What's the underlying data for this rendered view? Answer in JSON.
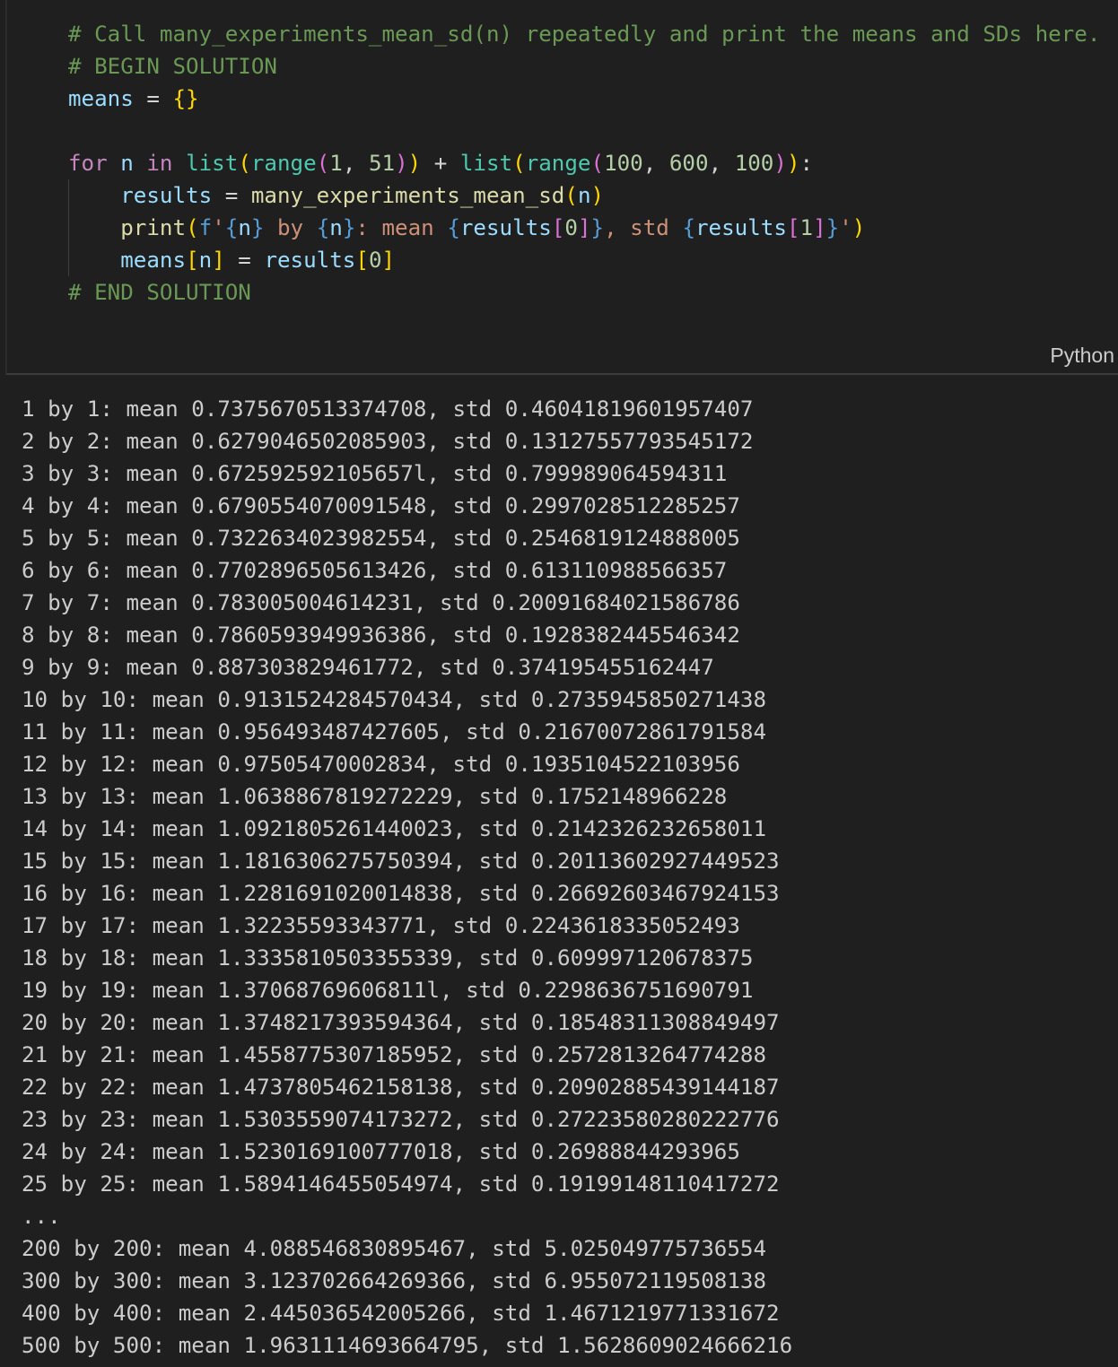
{
  "code_cell": {
    "language_label": "Python",
    "comment_line1": "# Call many_experiments_mean_sd(n) repeatedly and print the means and SDs here.",
    "comment_line2": "# BEGIN SOLUTION",
    "comment_end": "# END SOLUTION"
  },
  "output_lines": [
    "1 by 1: mean 0.7375670513374708, std 0.46041819601957407",
    "2 by 2: mean 0.6279046502085903, std 0.13127557793545172",
    "3 by 3: mean 0.672592592105657l, std 0.799989064594311",
    "4 by 4: mean 0.6790554070091548, std 0.2997028512285257",
    "5 by 5: mean 0.732263402398255­4, std 0.2546819124888005",
    "6 by 6: mean 0.7702896505613426, std 0.613110988566357",
    "7 by 7: mean 0.783005004614231, std 0.20091684021586786",
    "8 by 8: mean 0.7860593949936386, std 0.1928382445546342",
    "9 by 9: mean 0.887303829461772, std 0.374195455162447",
    "10 by 10: mean 0.9131524284570434, std 0.2735945850271438",
    "11 by 11: mean 0.956493487427605, std 0.21670072861791584",
    "12 by 12: mean 0.97505470002834, std 0.1935104522103956",
    "13 by 13: mean 1.0638867819272229, std 0.1752148966228",
    "14 by 14: mean 1.0921805261440023, std 0.2142326232658011",
    "15 by 15: mean 1.1816306275750394, std 0.20113602927449523",
    "16 by 16: mean 1.2281691020014838, std 0.26692603467924153",
    "17 by 17: mean 1.32235593343771, std 0.2243618335052493",
    "18 by 18: mean 1.3335810503355339, std 0.609997120678375",
    "19 by 19: mean 1.37068769606811l, std 0.2298636751690791",
    "20 by 20: mean 1.3748217393594364, std 0.18548311308849497",
    "21 by 21: mean 1.4558775307185952, std 0.2572813264774288",
    "22 by 22: mean 1.4737805462158138, std 0.20902885439144187",
    "23 by 23: mean 1.5303559074173272, std 0.27223580280222776",
    "24 by 24: mean 1.5230169100777018, std 0.26988844293965",
    "25 by 25: mean 1.5894146455054974, std 0.19199148110417272",
    "...",
    "200 by 200: mean 4.088546830895467, std 5.025049775736554",
    "300 by 300: mean 3.123702664269366, std 6.955072119508138",
    "400 by 400: mean 2.445036542005266, std 1.4671219771331672",
    "500 by 500: mean 1.9631114693664795, std 1.5628609024666216"
  ]
}
